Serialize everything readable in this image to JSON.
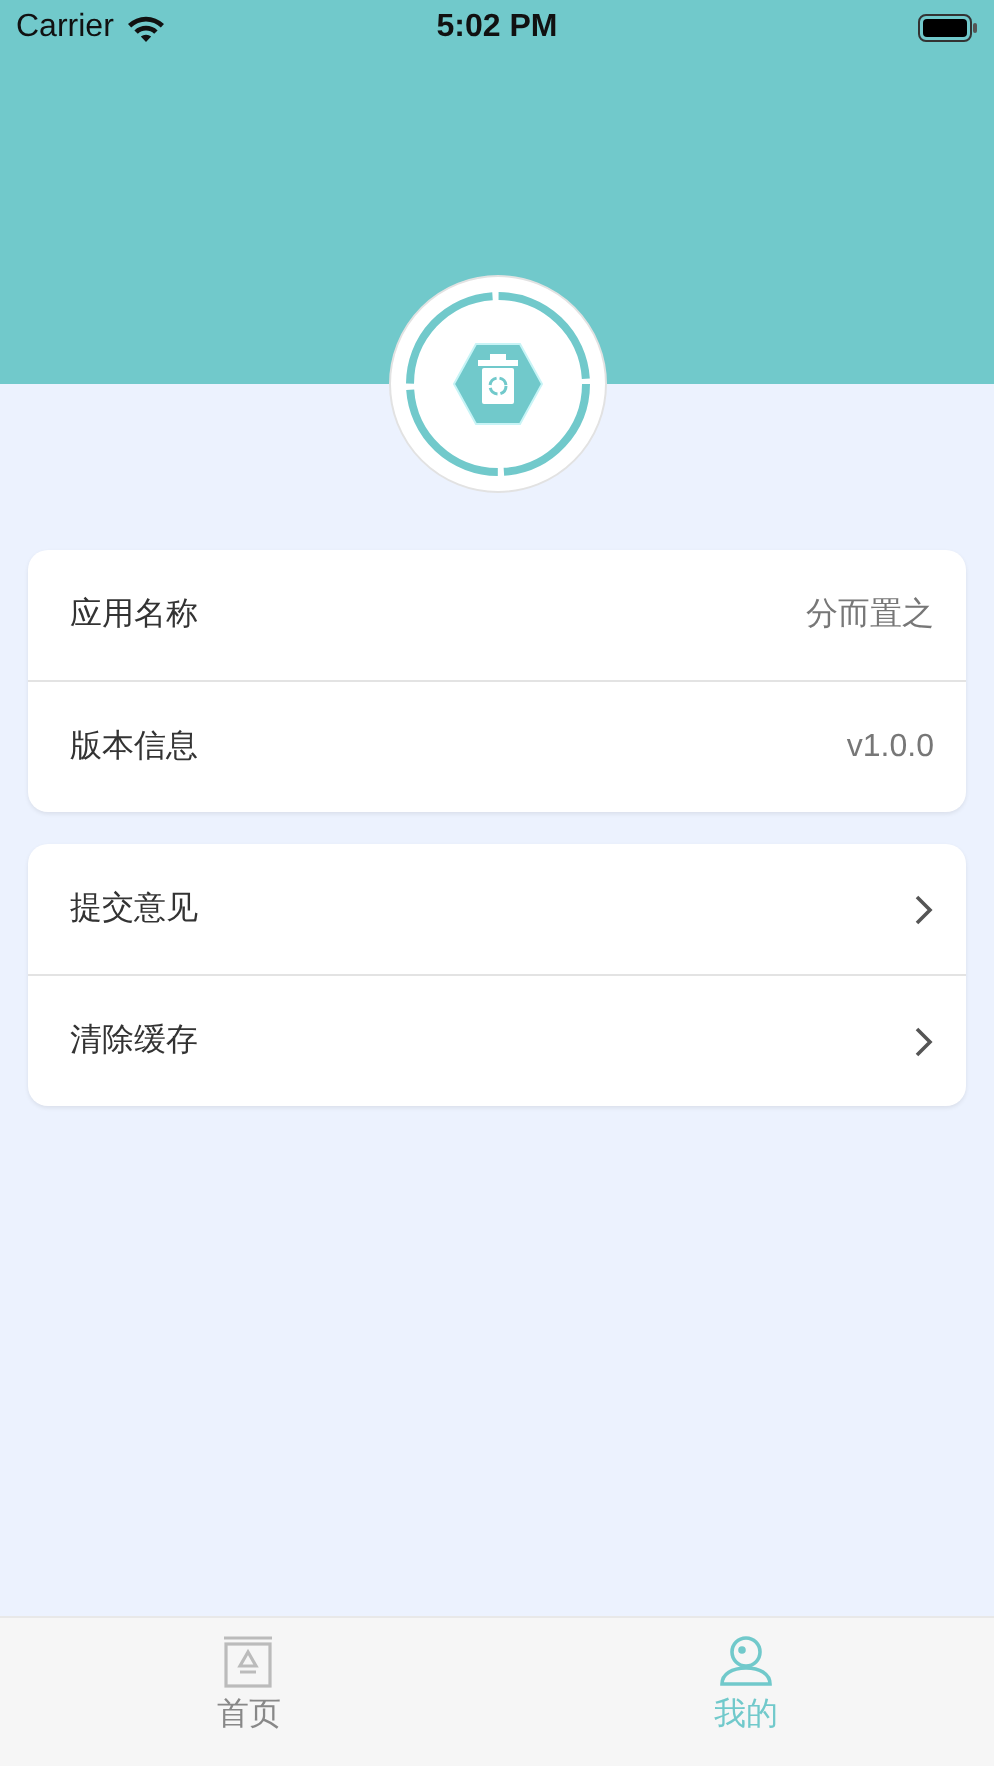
{
  "status_bar": {
    "carrier": "Carrier",
    "time": "5:02 PM"
  },
  "groups": [
    {
      "rows": [
        {
          "kind": "value",
          "label": "应用名称",
          "value": "分而置之"
        },
        {
          "kind": "value",
          "label": "版本信息",
          "value": "v1.0.0"
        }
      ]
    },
    {
      "rows": [
        {
          "kind": "link",
          "label": "提交意见"
        },
        {
          "kind": "link",
          "label": "清除缓存"
        }
      ]
    }
  ],
  "tab_bar": [
    {
      "kind": "home",
      "label": "首页",
      "selected": false
    },
    {
      "kind": "profile",
      "label": "我的",
      "selected": true
    }
  ]
}
